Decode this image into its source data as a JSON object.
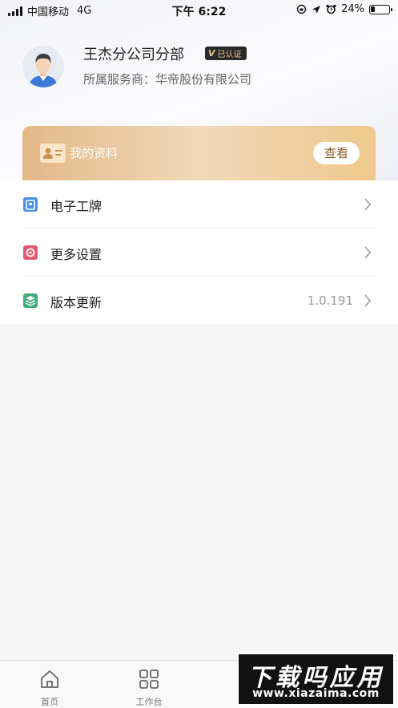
{
  "status_bar": {
    "carrier": "中国移动",
    "network": "4G",
    "time": "下午 6:22",
    "battery": "24%",
    "battery_level": 0.24
  },
  "profile": {
    "company": "王杰分公司分部",
    "verified_badge": {
      "mark": "V",
      "text": "已认证"
    },
    "provider_label": "所属服务商：",
    "provider_name": "华帝股份有限公司"
  },
  "profile_card": {
    "icon": "id-card-icon",
    "label": "我的资料",
    "action": "查看"
  },
  "menu": {
    "items": [
      {
        "icon": "badge-icon",
        "label": "电子工牌",
        "value": "",
        "color": "#4a90e2"
      },
      {
        "icon": "settings-icon",
        "label": "更多设置",
        "value": "",
        "color": "#e05a6d"
      },
      {
        "icon": "layers-icon",
        "label": "版本更新",
        "value": "1.0.191",
        "color": "#3dae7a"
      }
    ]
  },
  "tabbar": {
    "tabs": [
      {
        "icon": "home-icon",
        "label": "首页"
      },
      {
        "icon": "grid-icon",
        "label": "工作台"
      }
    ]
  },
  "watermark": {
    "title": "下载吗应用",
    "url": "www.xiazaima.com"
  }
}
